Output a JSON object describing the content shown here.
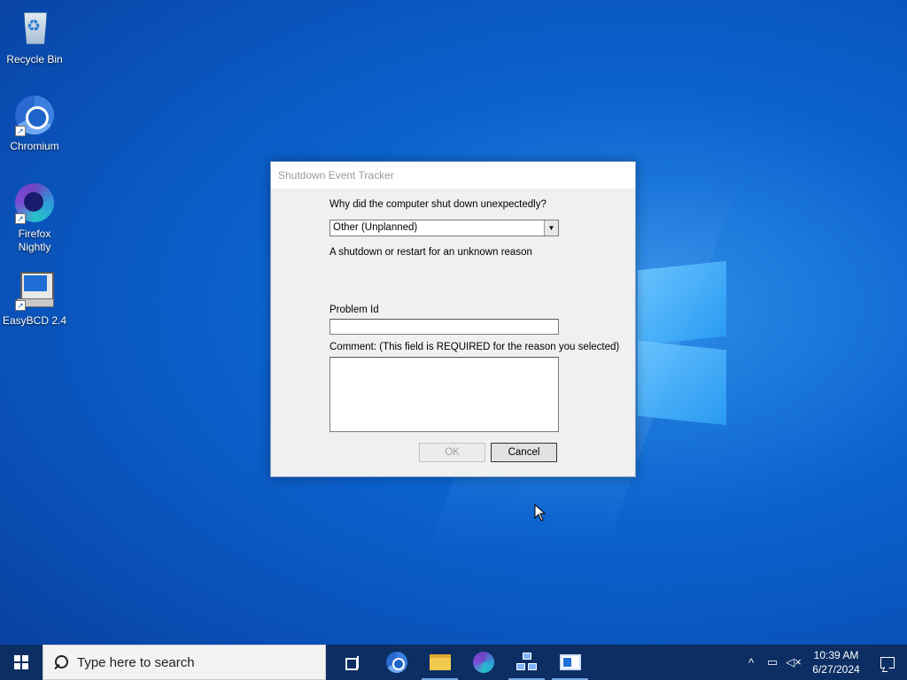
{
  "desktop": {
    "icons": [
      {
        "label": "Recycle Bin",
        "icon": "recycle-bin-icon"
      },
      {
        "label": "Chromium",
        "icon": "chromium-icon"
      },
      {
        "label": "Firefox Nightly",
        "icon": "firefox-nightly-icon"
      },
      {
        "label": "EasyBCD 2.4",
        "icon": "easybcd-icon"
      }
    ]
  },
  "dialog": {
    "title": "Shutdown Event Tracker",
    "question": "Why did the computer shut down unexpectedly?",
    "reason_selected": "Other (Unplanned)",
    "reason_description": "A shutdown or restart for an unknown reason",
    "problem_id_label": "Problem Id",
    "problem_id_value": "",
    "comment_label": "Comment: (This field is REQUIRED for the reason you selected)",
    "comment_value": "",
    "ok_label": "OK",
    "ok_enabled": false,
    "cancel_label": "Cancel"
  },
  "taskbar": {
    "search_placeholder": "Type here to search",
    "pinned": [
      {
        "name": "task-view",
        "icon": "task-view-icon"
      },
      {
        "name": "chromium",
        "icon": "chromium-icon"
      },
      {
        "name": "file-explorer",
        "icon": "folder-icon",
        "active": true
      },
      {
        "name": "firefox-nightly",
        "icon": "firefox-icon"
      },
      {
        "name": "network-app",
        "icon": "network-icon",
        "active": true
      },
      {
        "name": "shutdown-tracker-app",
        "icon": "window-app-icon",
        "active": true
      }
    ],
    "tray": {
      "time": "10:39 AM",
      "date": "6/27/2024"
    }
  },
  "colors": {
    "taskbar_bg": "#0c2e63",
    "desktop_bg": "#0b63cf",
    "dialog_bg": "#f0f0f0",
    "title_text": "#9a9a9a"
  }
}
